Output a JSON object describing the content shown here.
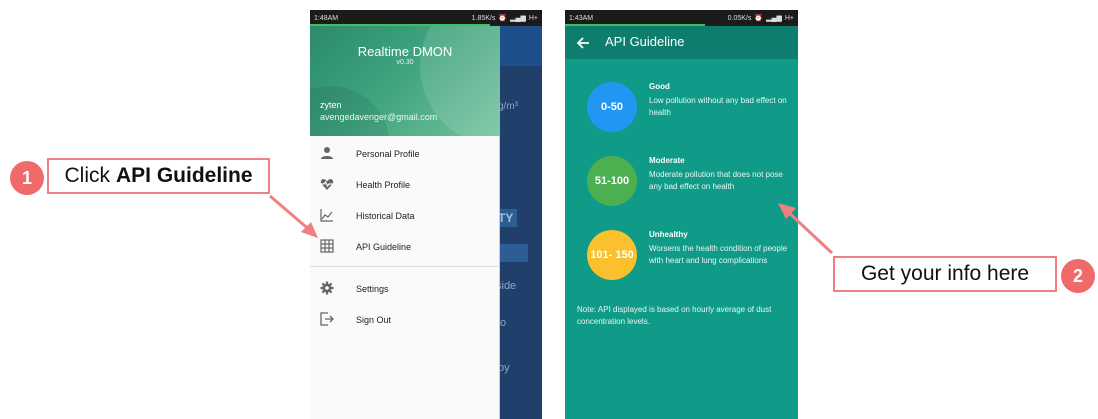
{
  "callouts": {
    "step1_number": "1",
    "step1_prefix": "Click",
    "step1_bold": "API Guideline",
    "step2_number": "2",
    "step2_text": "Get your info here"
  },
  "phone1": {
    "status": {
      "time": "1:48AM",
      "speed": "1.85K/s",
      "network": "H+"
    },
    "drawer": {
      "app_title": "Realtime DMON",
      "version": "v0.30",
      "user_name": "zyten",
      "user_email": "avengedavenger@gmail.com",
      "items": [
        {
          "label": "Personal Profile",
          "icon": "person-icon"
        },
        {
          "label": "Health Profile",
          "icon": "heart-pulse-icon"
        },
        {
          "label": "Historical Data",
          "icon": "line-chart-icon"
        },
        {
          "label": "API Guideline",
          "icon": "grid-icon"
        },
        {
          "label": "Settings",
          "icon": "gear-icon"
        },
        {
          "label": "Sign Out",
          "icon": "sign-out-icon"
        }
      ]
    },
    "background": {
      "unit": "g/m³",
      "btn1": "TY",
      "text1": "side",
      "text2": "o",
      "text3": "by"
    }
  },
  "phone2": {
    "status": {
      "time": "1:43AM",
      "speed": "0.05K/s",
      "network": "H+"
    },
    "toolbar_title": "API Guideline",
    "levels": [
      {
        "range": "0-50",
        "name": "Good",
        "desc": "Low pollution without any bad effect on health",
        "color": "#2196f3"
      },
      {
        "range": "51-100",
        "name": "Moderate",
        "desc": "Moderate pollution that does not pose any bad effect on health",
        "color": "#4caf50"
      },
      {
        "range": "101- 150",
        "name": "Unhealthy",
        "desc": "Worsens the health condition of people with heart and lung complications",
        "color": "#fbc02d"
      }
    ],
    "note": "Note: API displayed is based on hourly average of dust concentration levels."
  },
  "colors": {
    "accent": "#f06a6a",
    "teal": "#0f9b87",
    "teal_dark": "#0d7e6e"
  }
}
